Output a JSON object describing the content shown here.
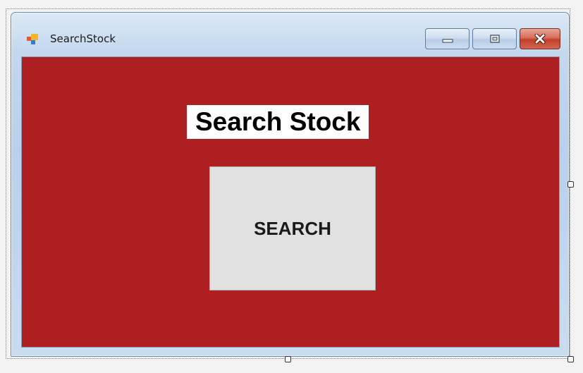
{
  "window": {
    "title": "SearchStock",
    "app_icon": "winforms-app-icon",
    "caption_buttons": [
      {
        "name": "minimize",
        "icon": "minimize-icon"
      },
      {
        "name": "maximize",
        "icon": "maximize-icon"
      },
      {
        "name": "close",
        "icon": "close-icon"
      }
    ]
  },
  "form": {
    "background_color": "#ae1f22",
    "heading": "Search Stock",
    "search_button_label": "SEARCH"
  }
}
